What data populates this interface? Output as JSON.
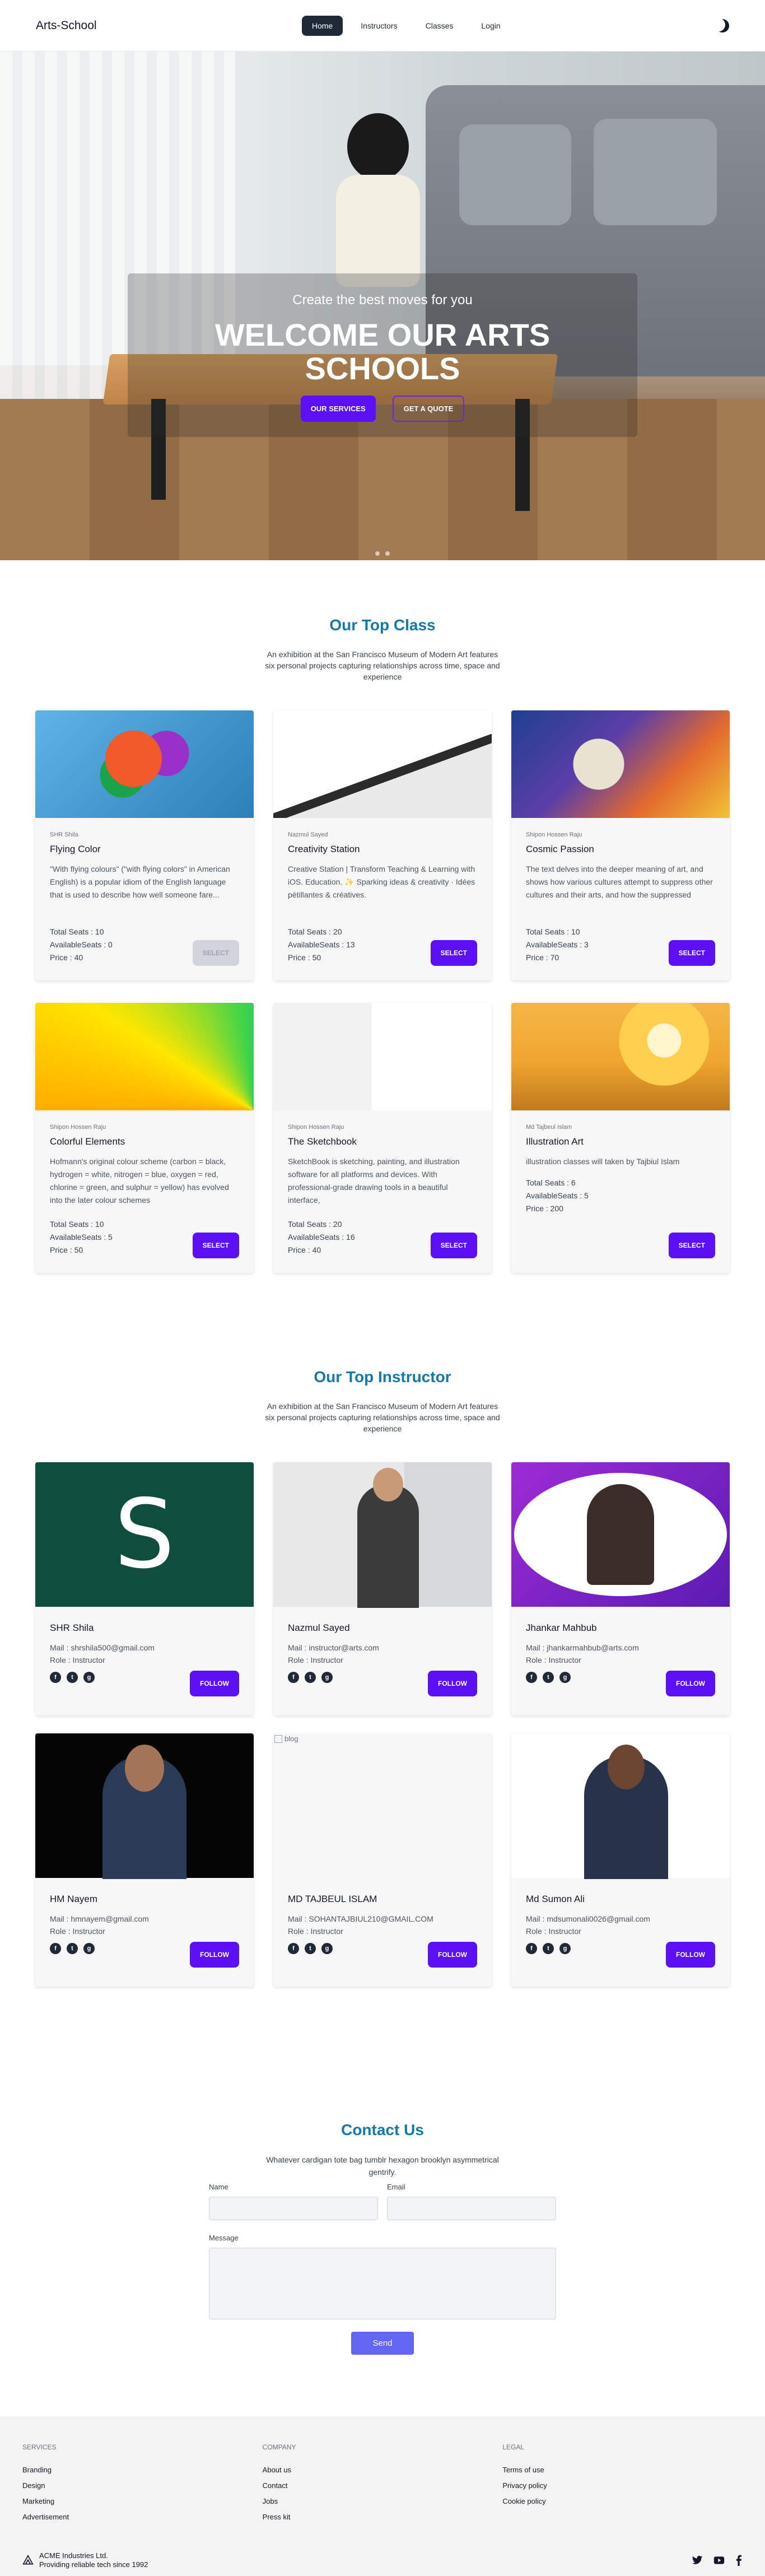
{
  "navbar": {
    "brand": "Arts-School",
    "links": [
      "Home",
      "Instructors",
      "Classes",
      "Login"
    ]
  },
  "hero": {
    "subtitle": "Create the best moves for you",
    "title": "WELCOME OUR ARTS SCHOOLS",
    "primary_cta": "OUR SERVICES",
    "secondary_cta": "GET A QUOTE"
  },
  "classes": {
    "title": "Our Top Class",
    "subtitle": "An exhibition at the San Francisco Museum of Modern Art features six personal projects capturing relationships across time, space and experience",
    "items": [
      {
        "instructor": "SHR Shila",
        "name": "Flying Color",
        "description": "\"With flying colours\" (\"with flying colors\" in American English) is a popular idiom of the English language that is used to describe how well someone fare...",
        "total_seats": "Total Seats : 10",
        "available_seats": "AvailableSeats : 0",
        "price": "Price : 40",
        "button": "SELECT"
      },
      {
        "instructor": "Nazmul Sayed",
        "name": "Creativity Station",
        "description": "Creative Station | Transform Teaching & Learning with iOS. Education. ✨ Sparking ideas & creativity · Idées pétillantes & créatives.",
        "total_seats": "Total Seats : 20",
        "available_seats": "AvailableSeats : 13",
        "price": "Price : 50",
        "button": "SELECT"
      },
      {
        "instructor": "Shipon Hossen Raju",
        "name": "Cosmic Passion",
        "description": "The text delves into the deeper meaning of art, and shows how various cultures attempt to suppress other cultures and their arts, and how the suppressed",
        "total_seats": "Total Seats : 10",
        "available_seats": "AvailableSeats : 3",
        "price": "Price : 70",
        "button": "SELECT"
      },
      {
        "instructor": "Shipon Hossen Raju",
        "name": "Colorful Elements",
        "description": "Hofmann's original colour scheme (carbon = black, hydrogen = white, nitrogen = blue, oxygen = red, chlorine = green, and sulphur = yellow) has evolved into the later colour schemes",
        "total_seats": "Total Seats : 10",
        "available_seats": "AvailableSeats : 5",
        "price": "Price : 50",
        "button": "SELECT"
      },
      {
        "instructor": "Shipon Hossen Raju",
        "name": "The Sketchbook",
        "description": "SketchBook is sketching, painting, and illustration software for all platforms and devices. With professional-grade drawing tools in a beautiful interface,",
        "total_seats": "Total Seats : 20",
        "available_seats": "AvailableSeats : 16",
        "price": "Price : 40",
        "button": "SELECT"
      },
      {
        "instructor": "Md Tajbeul Islam",
        "name": "Illustration Art",
        "description": "illustration classes will taken by Tajbiul Islam",
        "total_seats": "Total Seats : 6",
        "available_seats": "AvailableSeats : 5",
        "price": "Price : 200",
        "button": "SELECT"
      }
    ]
  },
  "instructors": {
    "title": "Our Top Instructor",
    "subtitle": "An exhibition at the San Francisco Museum of Modern Art features six personal projects capturing relationships across time, space and experience",
    "photo_letter": "S",
    "broken_image_alt": "blog",
    "items": [
      {
        "name": "SHR Shila",
        "mail": "Mail : shrshila500@gmail.com",
        "role": "Role : Instructor",
        "button": "FOLLOW"
      },
      {
        "name": "Nazmul Sayed",
        "mail": "Mail : instructor@arts.com",
        "role": "Role : Instructor",
        "button": "FOLLOW"
      },
      {
        "name": "Jhankar Mahbub",
        "mail": "Mail : jhankarmahbub@arts.com",
        "role": "Role : Instructor",
        "button": "FOLLOW"
      },
      {
        "name": "HM Nayem",
        "mail": "Mail : hmnayem@gmail.com",
        "role": "Role : Instructor",
        "button": "FOLLOW"
      },
      {
        "name": "MD TAJBEUL ISLAM",
        "mail": "Mail : SOHANTAJBIUL210@GMAIL.COM",
        "role": "Role : Instructor",
        "button": "FOLLOW"
      },
      {
        "name": "Md Sumon Ali",
        "mail": "Mail : mdsumonali0026@gmail.com",
        "role": "Role : Instructor",
        "button": "FOLLOW"
      }
    ]
  },
  "contact": {
    "title": "Contact Us",
    "subtitle": "Whatever cardigan tote bag tumblr hexagon brooklyn asymmetrical gentrify.",
    "name_label": "Name",
    "email_label": "Email",
    "message_label": "Message",
    "send_label": "Send"
  },
  "footer": {
    "services": {
      "heading": "SERVICES",
      "items": [
        "Branding",
        "Design",
        "Marketing",
        "Advertisement"
      ]
    },
    "company": {
      "heading": "COMPANY",
      "items": [
        "About us",
        "Contact",
        "Jobs",
        "Press kit"
      ]
    },
    "legal": {
      "heading": "LEGAL",
      "items": [
        "Terms of use",
        "Privacy policy",
        "Cookie policy"
      ]
    },
    "company_name": "ACME Industries Ltd.",
    "tagline": "Providing reliable tech since 1992"
  },
  "colors": {
    "accent": "#5b10f5",
    "section_title": "#1479a9",
    "send_button": "#6366f1"
  }
}
